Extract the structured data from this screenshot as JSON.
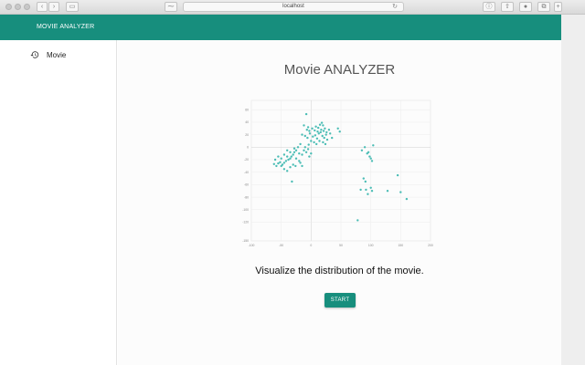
{
  "browser": {
    "url": "localhost"
  },
  "header": {
    "title": "MOVIE ANALYZER",
    "color": "#178e7d"
  },
  "sidebar": {
    "items": [
      {
        "label": "Movie",
        "icon": "history-icon"
      }
    ]
  },
  "main": {
    "title": "Movie ANALYZER",
    "subtitle": "Visualize the distribution of the movie.",
    "start_label": "START",
    "accent": "#178e7d"
  },
  "chart_data": {
    "type": "scatter",
    "title": "",
    "xlabel": "",
    "ylabel": "",
    "xlim": [
      -100,
      200
    ],
    "ylim": [
      -150,
      75
    ],
    "x_ticks": [
      -100,
      -50,
      0,
      50,
      100,
      150,
      200
    ],
    "y_ticks": [
      60,
      40,
      20,
      0,
      -20,
      -40,
      -60,
      -80,
      -100,
      -120,
      -150
    ],
    "y_tick_labels": [
      "60",
      "40",
      "20",
      "0",
      "-20",
      "-40",
      "-60",
      "-80",
      "-100",
      "-120",
      "-150"
    ],
    "grid": true,
    "point_color": "#4bbdb5",
    "series": [
      {
        "points": [
          [
            -8,
            53
          ],
          [
            -12,
            35
          ],
          [
            -5,
            32
          ],
          [
            2,
            30
          ],
          [
            8,
            33
          ],
          [
            12,
            31
          ],
          [
            15,
            36
          ],
          [
            18,
            39
          ],
          [
            20,
            35
          ],
          [
            23,
            30
          ],
          [
            -15,
            20
          ],
          [
            -10,
            18
          ],
          [
            -6,
            15
          ],
          [
            -2,
            22
          ],
          [
            3,
            17
          ],
          [
            7,
            19
          ],
          [
            10,
            14
          ],
          [
            13,
            22
          ],
          [
            16,
            24
          ],
          [
            19,
            18
          ],
          [
            22,
            15
          ],
          [
            25,
            20
          ],
          [
            27,
            12
          ],
          [
            5,
            8
          ],
          [
            0,
            10
          ],
          [
            -4,
            4
          ],
          [
            9,
            5
          ],
          [
            14,
            10
          ],
          [
            20,
            8
          ],
          [
            24,
            5
          ],
          [
            -7,
            28
          ],
          [
            -3,
            26
          ],
          [
            6,
            27
          ],
          [
            11,
            25
          ],
          [
            17,
            28
          ],
          [
            21,
            26
          ],
          [
            26,
            24
          ],
          [
            30,
            28
          ],
          [
            32,
            22
          ],
          [
            35,
            15
          ],
          [
            45,
            30
          ],
          [
            48,
            25
          ],
          [
            -18,
            5
          ],
          [
            -22,
            0
          ],
          [
            -25,
            -5
          ],
          [
            -28,
            -8
          ],
          [
            -30,
            -12
          ],
          [
            -33,
            -15
          ],
          [
            -35,
            -18
          ],
          [
            -38,
            -20
          ],
          [
            -40,
            -15
          ],
          [
            -42,
            -22
          ],
          [
            -45,
            -25
          ],
          [
            -48,
            -28
          ],
          [
            -50,
            -30
          ],
          [
            -52,
            -24
          ],
          [
            -55,
            -26
          ],
          [
            -58,
            -30
          ],
          [
            -60,
            -20
          ],
          [
            -62,
            -27
          ],
          [
            -20,
            -10
          ],
          [
            -15,
            -12
          ],
          [
            -12,
            -5
          ],
          [
            -10,
            0
          ],
          [
            -8,
            -8
          ],
          [
            -5,
            -3
          ],
          [
            -3,
            -15
          ],
          [
            0,
            -10
          ],
          [
            -25,
            -18
          ],
          [
            -20,
            -22
          ],
          [
            -35,
            -8
          ],
          [
            -40,
            -5
          ],
          [
            -45,
            -12
          ],
          [
            -50,
            -18
          ],
          [
            -55,
            -15
          ],
          [
            -45,
            -35
          ],
          [
            -40,
            -38
          ],
          [
            -35,
            -32
          ],
          [
            -30,
            -28
          ],
          [
            -26,
            -30
          ],
          [
            -32,
            -55
          ],
          [
            -28,
            -2
          ],
          [
            -18,
            -25
          ],
          [
            -15,
            -30
          ],
          [
            85,
            -5
          ],
          [
            90,
            0
          ],
          [
            94,
            -10
          ],
          [
            98,
            -15
          ],
          [
            100,
            -18
          ],
          [
            96,
            -8
          ],
          [
            102,
            -22
          ],
          [
            104,
            3
          ],
          [
            88,
            -50
          ],
          [
            91,
            -55
          ],
          [
            92,
            -68
          ],
          [
            95,
            -75
          ],
          [
            83,
            -68
          ],
          [
            100,
            -65
          ],
          [
            102,
            -70
          ],
          [
            128,
            -70
          ],
          [
            150,
            -72
          ],
          [
            160,
            -83
          ],
          [
            145,
            -45
          ],
          [
            78,
            -117
          ]
        ]
      }
    ]
  }
}
